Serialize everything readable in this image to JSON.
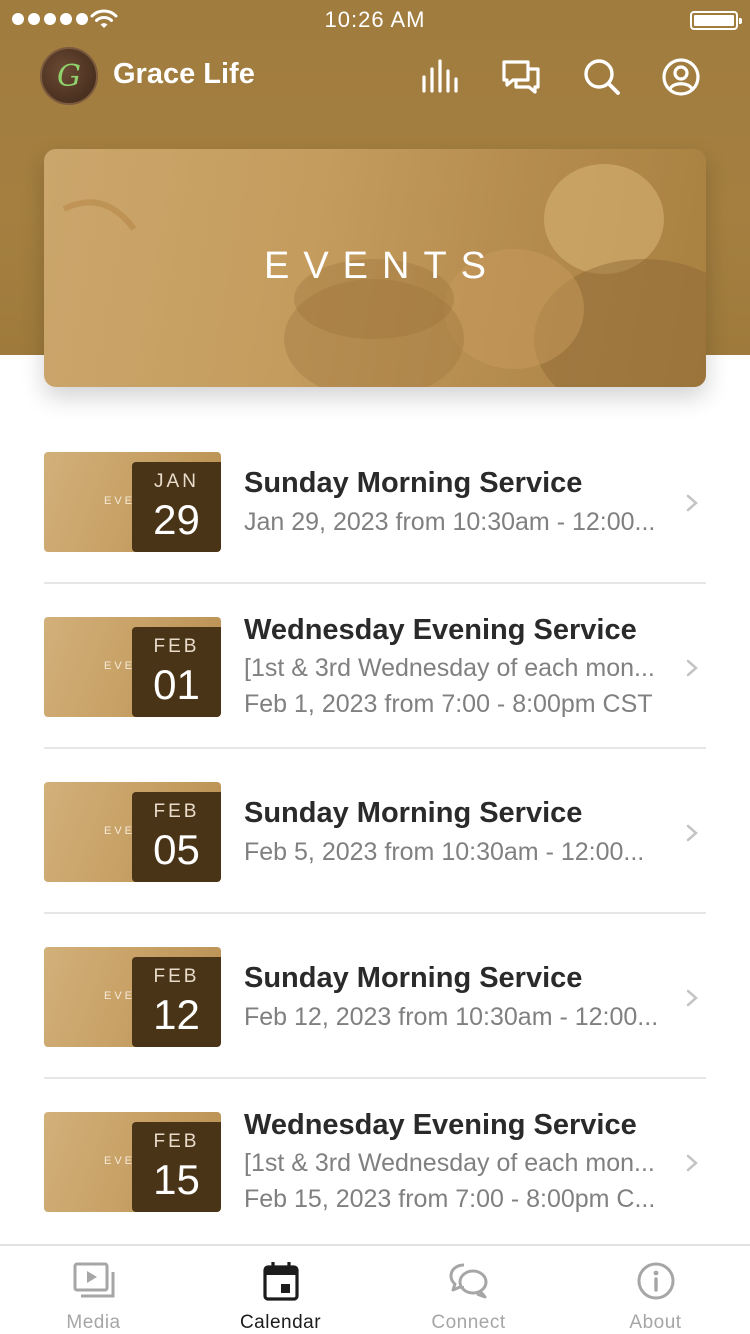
{
  "status_bar": {
    "time": "10:26 AM"
  },
  "header": {
    "brand": "Grace Life",
    "logo_letter": "G"
  },
  "banner": {
    "title": "EVENTS"
  },
  "events": [
    {
      "month": "JAN",
      "day": "29",
      "thumb_word": "EVENTS",
      "title": "Sunday Morning Service",
      "line1": "Jan 29, 2023 from 10:30am - 12:00...",
      "line2": ""
    },
    {
      "month": "FEB",
      "day": "01",
      "thumb_word": "EVENTS",
      "title": "Wednesday Evening Service",
      "line1": "[1st & 3rd Wednesday of each mon...",
      "line2": "Feb 1, 2023 from 7:00 - 8:00pm CST"
    },
    {
      "month": "FEB",
      "day": "05",
      "thumb_word": "EVENTS",
      "title": "Sunday Morning Service",
      "line1": "Feb 5, 2023 from 10:30am - 12:00...",
      "line2": ""
    },
    {
      "month": "FEB",
      "day": "12",
      "thumb_word": "EVENTS",
      "title": "Sunday Morning Service",
      "line1": "Feb 12, 2023 from 10:30am - 12:00...",
      "line2": ""
    },
    {
      "month": "FEB",
      "day": "15",
      "thumb_word": "EVENTS",
      "title": "Wednesday Evening Service",
      "line1": "[1st & 3rd Wednesday of each mon...",
      "line2": "Feb 15, 2023 from 7:00 - 8:00pm C..."
    }
  ],
  "tabs": [
    {
      "label": "Media",
      "icon": "media-icon",
      "active": false
    },
    {
      "label": "Calendar",
      "icon": "calendar-icon",
      "active": true
    },
    {
      "label": "Connect",
      "icon": "chat-bubbles-icon",
      "active": false
    },
    {
      "label": "About",
      "icon": "info-icon",
      "active": false
    }
  ],
  "colors": {
    "brand_gold": "#a07c3f",
    "date_box": "#4a3417",
    "active_tab": "#1c1c1c",
    "inactive_tab": "#a6a6a6"
  }
}
